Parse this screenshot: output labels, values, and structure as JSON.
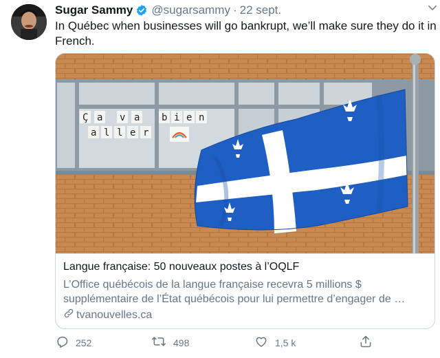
{
  "tweet": {
    "display_name": "Sugar Sammy",
    "handle": "@sugarsammy",
    "separator": "·",
    "date": "22 sept.",
    "text": "In Québec when businesses will go bankrupt, we’ll make sure they do it in French."
  },
  "card": {
    "title": "Langue française: 50 nouveaux postes à l’OQLF",
    "description": "L’Office québécois de la langue française recevra 5 millions $ supplémentaire de l’État québécois pour lui permettre d’engager de …",
    "domain": "tvanouvelles.ca",
    "window_letters": [
      "Ç",
      "a",
      "v",
      "a",
      "b",
      "i",
      "e",
      "n",
      "a",
      "l",
      "l",
      "e",
      "r"
    ]
  },
  "actions": {
    "reply_count": "252",
    "retweet_count": "498",
    "like_count": "1,5 k"
  },
  "colors": {
    "verified_badge": "#1da1f2",
    "secondary_text": "#657786",
    "flag_blue": "#1f5fc4",
    "brick": "#c98a52"
  },
  "icons": {
    "verified": "verified-badge-icon",
    "caret": "chevron-down-icon",
    "link": "link-icon",
    "reply": "reply-icon",
    "retweet": "retweet-icon",
    "like": "heart-icon",
    "share": "share-icon"
  }
}
